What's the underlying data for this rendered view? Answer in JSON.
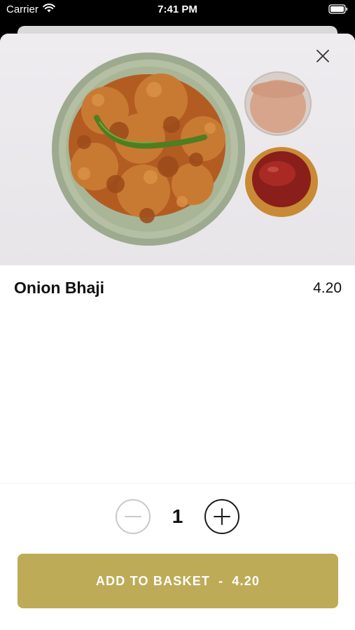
{
  "status_bar": {
    "carrier": "Carrier",
    "time": "7:41 PM",
    "icons": [
      "wifi-icon",
      "battery-icon"
    ]
  },
  "product": {
    "image": "food-photo",
    "name": "Onion Bhaji",
    "price": "4.20"
  },
  "quantity": {
    "value": "1",
    "decrease_icon": "minus-icon",
    "increase_icon": "plus-icon"
  },
  "add_button": {
    "label": "ADD TO BASKET",
    "separator": "-",
    "price": "4.20"
  },
  "colors": {
    "accent": "#bdab58",
    "minus_border": "#c9c9c9",
    "plus_border": "#1b1b1b"
  },
  "close_icon": "close-icon"
}
